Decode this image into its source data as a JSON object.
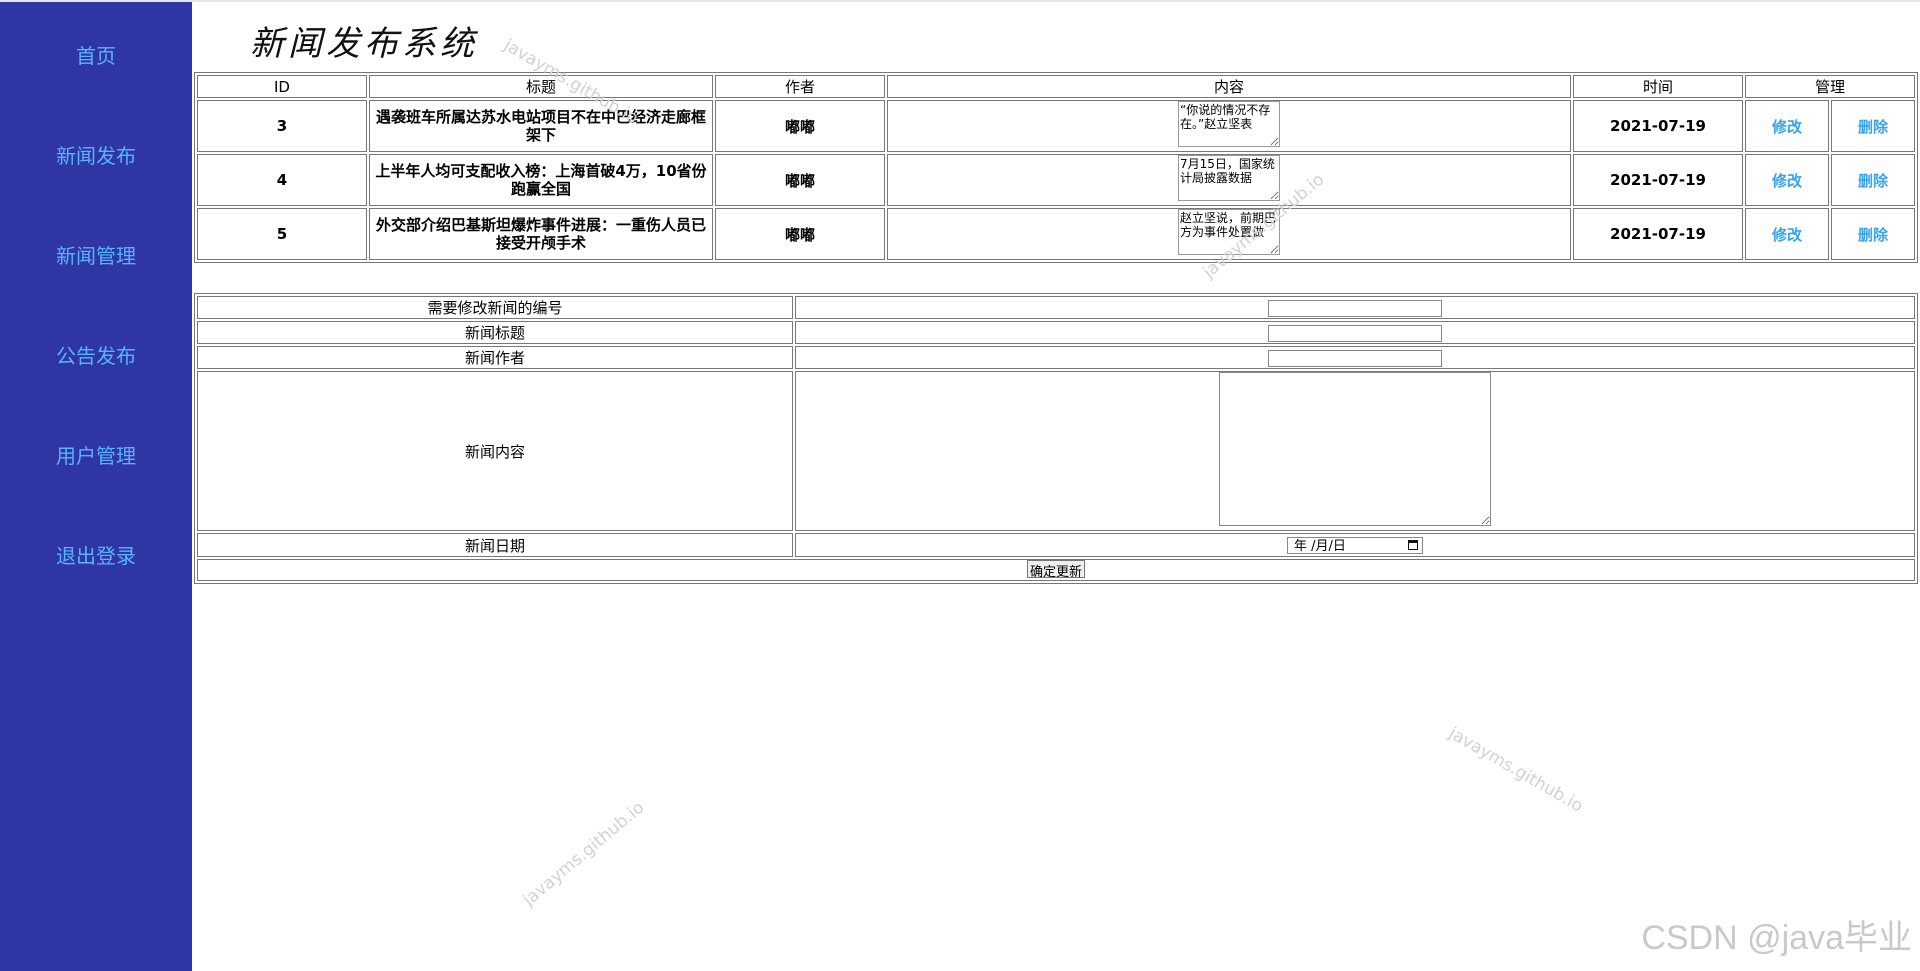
{
  "sidebar": {
    "items": [
      {
        "label": "首页"
      },
      {
        "label": "新闻发布"
      },
      {
        "label": "新闻管理"
      },
      {
        "label": "公告发布"
      },
      {
        "label": "用户管理"
      },
      {
        "label": "退出登录"
      }
    ]
  },
  "header": {
    "title": "新闻发布系统"
  },
  "news_table": {
    "headers": [
      "ID",
      "标题",
      "作者",
      "内容",
      "时间",
      "管理"
    ],
    "rows": [
      {
        "id": "3",
        "title": "遇袭班车所属达苏水电站项目不在中巴经济走廊框架下",
        "author": "嘟嘟",
        "content": "“你说的情况不存在。”赵立坚表",
        "time": "2021-07-19",
        "edit": "修改",
        "delete": "删除"
      },
      {
        "id": "4",
        "title": "上半年人均可支配收入榜：上海首破4万，10省份跑赢全国",
        "author": "嘟嘟",
        "content": "7月15日，国家统计局披露数据",
        "time": "2021-07-19",
        "edit": "修改",
        "delete": "删除"
      },
      {
        "id": "5",
        "title": "外交部介绍巴基斯坦爆炸事件进展：一重伤人员已接受开颅手术",
        "author": "嘟嘟",
        "content": "赵立坚说，前期巴方为事件处置做",
        "time": "2021-07-19",
        "edit": "修改",
        "delete": "删除"
      }
    ]
  },
  "edit_form": {
    "id_label": "需要修改新闻的编号",
    "title_label": "新闻标题",
    "author_label": "新闻作者",
    "content_label": "新闻内容",
    "date_label": "新闻日期",
    "date_placeholder": "年 /月/日",
    "submit_label": "确定更新"
  },
  "watermarks": [
    "javayms.github.io",
    "javayms.github.io",
    "javayms.github.io",
    "javayms.github.io"
  ],
  "footer_mark": "CSDN @java毕业",
  "colors": {
    "sidebar_bg": "#3035a6",
    "nav_text": "#57b4ff",
    "link": "#3aa3f0"
  }
}
